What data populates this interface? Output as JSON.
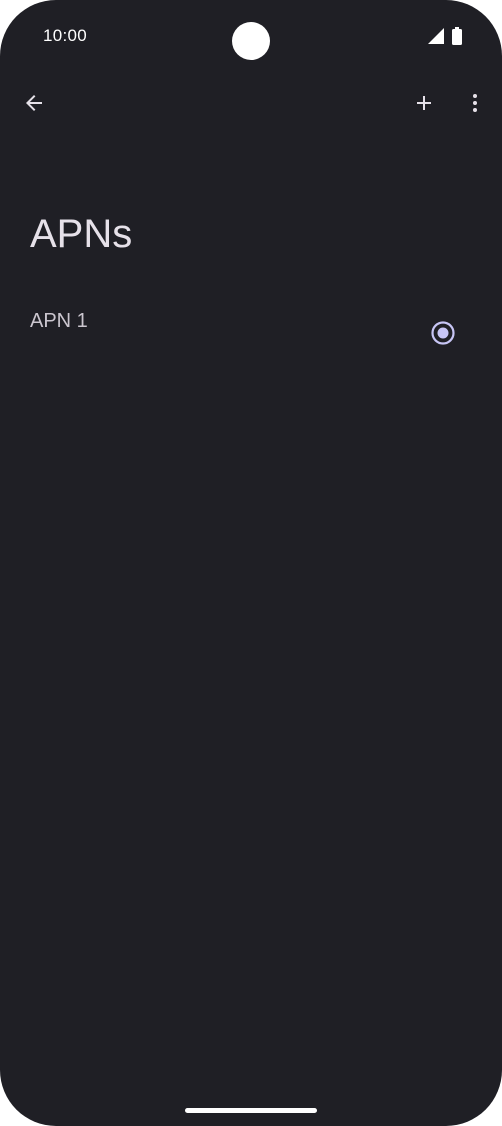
{
  "status_bar": {
    "time": "10:00",
    "icons": [
      "signal-icon",
      "battery-icon"
    ]
  },
  "app_bar": {
    "back_icon": "arrow-back-icon",
    "add_icon": "plus-icon",
    "more_icon": "more-vert-icon"
  },
  "page": {
    "title": "APNs"
  },
  "apn_list": {
    "items": [
      {
        "name": "APN 1",
        "selected": true
      }
    ]
  },
  "colors": {
    "background": "#1f1f25",
    "text_primary": "#e6e1e9",
    "text_secondary": "#cbc6cf",
    "accent": "#c7c5f5"
  }
}
